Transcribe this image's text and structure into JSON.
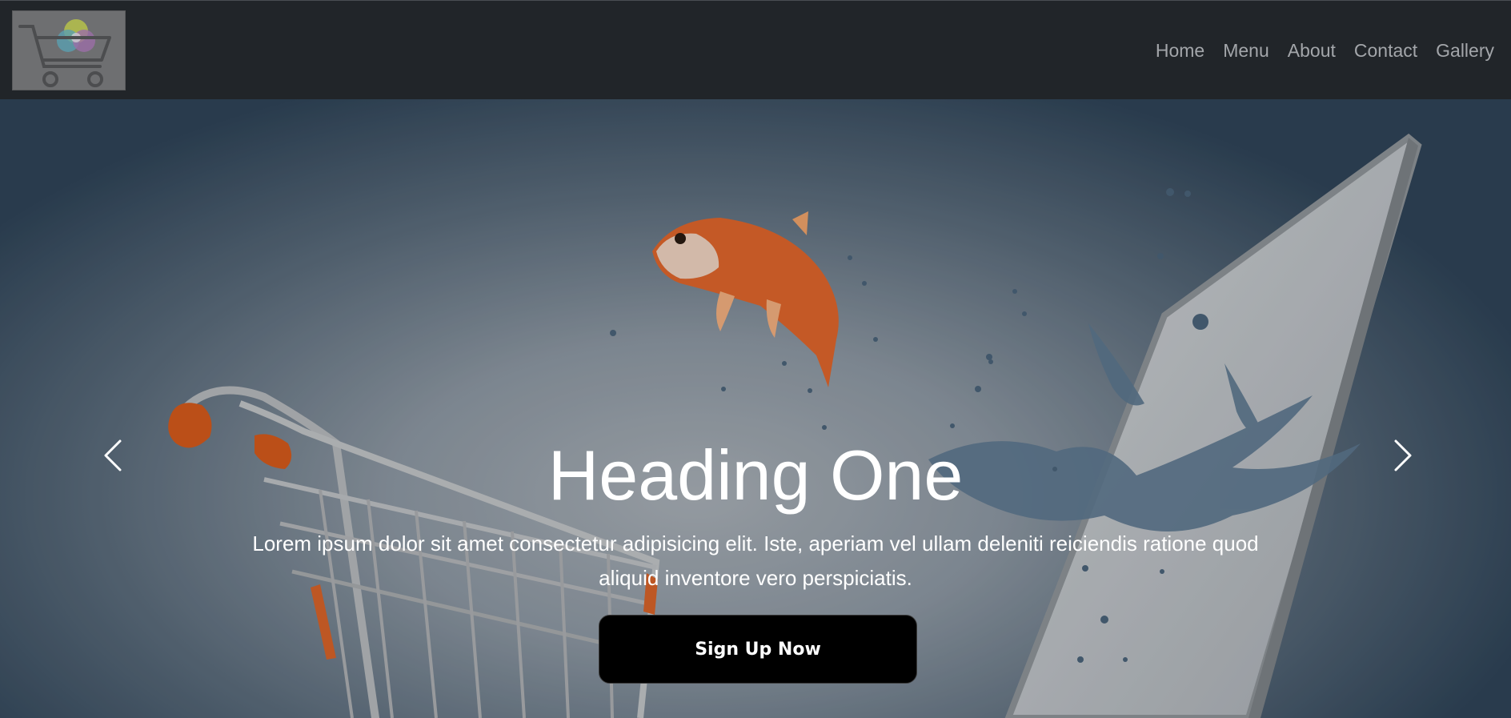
{
  "navbar": {
    "logo_icon": "shopping-cart-color-wheel-logo",
    "links": [
      {
        "label": "Home"
      },
      {
        "label": "Menu"
      },
      {
        "label": "About"
      },
      {
        "label": "Contact"
      },
      {
        "label": "Gallery"
      }
    ]
  },
  "hero": {
    "heading": "Heading One",
    "text": "Lorem ipsum dolor sit amet consectetur adipisicing elit. Iste, aperiam vel ullam deleniti reiciendis ratione quod aliquid inventore vero perspiciatis.",
    "button_label": "Sign Up Now",
    "prev_icon": "chevron-left-icon",
    "next_icon": "chevron-right-icon"
  },
  "colors": {
    "navbar_bg": "#212529",
    "nav_link": "#a3a6aa",
    "button_bg": "#000000",
    "accent_orange": "#e0602a"
  }
}
